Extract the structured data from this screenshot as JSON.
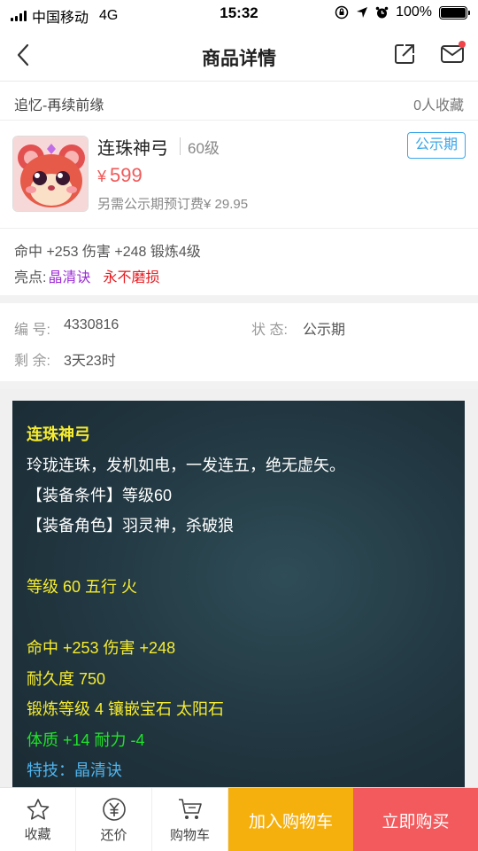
{
  "status_bar": {
    "carrier": "中国移动",
    "network": "4G",
    "time": "15:32",
    "battery": "100%"
  },
  "nav": {
    "title": "商品详情",
    "back_icon": "chevron-left-icon",
    "share_icon": "share-icon",
    "mail_icon": "mail-icon"
  },
  "header": {
    "server": "追忆-再续前缘",
    "favorites": "0人收藏"
  },
  "item": {
    "name": "连珠神弓",
    "level": "60级",
    "badge": "公示期",
    "currency": "¥",
    "price": "599",
    "fee": "另需公示期预订费¥ 29.95"
  },
  "stats": {
    "line": "命中 +253 伤害 +248 锻炼4级",
    "highlight_label": "亮点:",
    "highlight_1": "晶清诀",
    "highlight_2": "永不磨损"
  },
  "info": {
    "id_label": "编 号:",
    "id_value": "4330816",
    "status_label": "状 态:",
    "status_value": "公示期",
    "remain_label": "剩 余:",
    "remain_value": "3天23时"
  },
  "description": {
    "name": "连珠神弓",
    "flavor": "玲珑连珠，发机如电，一发连五，绝无虚矢。",
    "req_level": "【装备条件】等级60",
    "req_role": "【装备角色】羽灵神，杀破狼",
    "level_element": "等级 60 五行 火",
    "hit_damage": "命中 +253 伤害 +248",
    "durability": "耐久度 750",
    "forge": "锻炼等级 4 镶嵌宝石 太阳石",
    "attrs": "体质 +14 耐力 -4",
    "skill": "特技：晶清诀"
  },
  "bottom_bar": {
    "favorite": "收藏",
    "bargain": "还价",
    "cart": "购物车",
    "add_to_cart": "加入购物车",
    "buy_now": "立即购买"
  },
  "colors": {
    "price_red": "#f05a5a",
    "badge_blue": "#39a6e8",
    "add_cart_orange": "#f5b00e",
    "buy_red": "#f25a5d",
    "desc_yellow": "#f6ec30",
    "desc_green": "#20e22a",
    "desc_blue": "#4fb4ee",
    "highlight_purple": "#9c2bd7",
    "highlight_red": "#e7181d"
  }
}
